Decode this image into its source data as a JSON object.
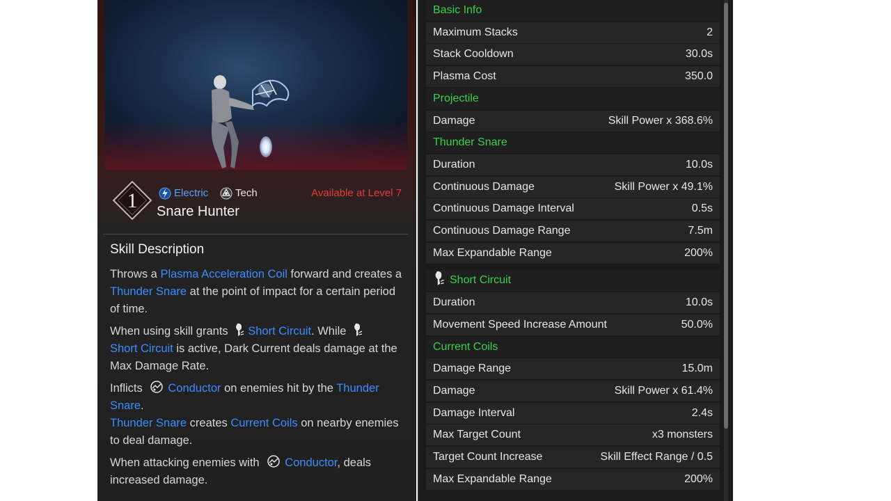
{
  "skill": {
    "level": "1",
    "element_tag": "Electric",
    "type_tag": "Tech",
    "name": "Snare Hunter",
    "availability": "Available at Level 7"
  },
  "description": {
    "title": "Skill Description",
    "p1": {
      "t1": "Throws a ",
      "k1": "Plasma Acceleration Coil",
      "t2": " forward and creates a ",
      "k2": "Thunder Snare",
      "t3": " at the point of impact for a certain period of time."
    },
    "p2": {
      "t1": "When using skill grants ",
      "k1": "Short Circuit",
      "t2": ". While ",
      "k2": "Short Circuit",
      "t3": " is active, Dark Current deals damage at the Max Damage Rate."
    },
    "p3": {
      "t1": "Inflicts ",
      "k1": "Conductor",
      "t2": " on enemies hit by the ",
      "k2": "Thunder Snare",
      "t3": ".",
      "k3": "Thunder Snare",
      "t4": " creates ",
      "k4": "Current Coils",
      "t5": " on nearby enemies to deal damage."
    },
    "p4": {
      "t1": "When attacking enemies with ",
      "k1": "Conductor",
      "t2": ", deals increased damage."
    }
  },
  "stats": [
    {
      "kind": "section",
      "label": "Basic Info"
    },
    {
      "kind": "row",
      "label": "Maximum Stacks",
      "value": "2"
    },
    {
      "kind": "row",
      "label": "Stack Cooldown",
      "value": "30.0s"
    },
    {
      "kind": "row",
      "label": "Plasma Cost",
      "value": "350.0"
    },
    {
      "kind": "section",
      "label": "Projectile"
    },
    {
      "kind": "row",
      "label": "Damage",
      "value": "Skill Power x 368.6%"
    },
    {
      "kind": "section",
      "label": "Thunder Snare"
    },
    {
      "kind": "row",
      "label": "Duration",
      "value": "10.0s"
    },
    {
      "kind": "row",
      "label": "Continuous Damage",
      "value": "Skill Power x 49.1%"
    },
    {
      "kind": "row",
      "label": "Continuous Damage Interval",
      "value": "0.5s"
    },
    {
      "kind": "row",
      "label": "Continuous Damage Range",
      "value": "7.5m"
    },
    {
      "kind": "row",
      "label": "Max Expandable Range",
      "value": "200%"
    },
    {
      "kind": "section",
      "label": "Short Circuit",
      "icon": "short-circuit-icon"
    },
    {
      "kind": "row",
      "label": "Duration",
      "value": "10.0s"
    },
    {
      "kind": "row",
      "label": "Movement Speed Increase Amount",
      "value": "50.0%"
    },
    {
      "kind": "section",
      "label": "Current Coils"
    },
    {
      "kind": "row",
      "label": "Damage Range",
      "value": "15.0m"
    },
    {
      "kind": "row",
      "label": "Damage",
      "value": "Skill Power x 61.4%"
    },
    {
      "kind": "row",
      "label": "Damage Interval",
      "value": "2.4s"
    },
    {
      "kind": "row",
      "label": "Max Target Count",
      "value": "x3 monsters"
    },
    {
      "kind": "row",
      "label": "Target Count Increase",
      "value": "Skill Effect Range / 0.5"
    },
    {
      "kind": "row",
      "label": "Max Expandable Range",
      "value": "200%"
    }
  ],
  "colors": {
    "section_green": "#38d24a",
    "keyword_blue": "#3d8cff",
    "availability_red": "#e43c3c"
  }
}
